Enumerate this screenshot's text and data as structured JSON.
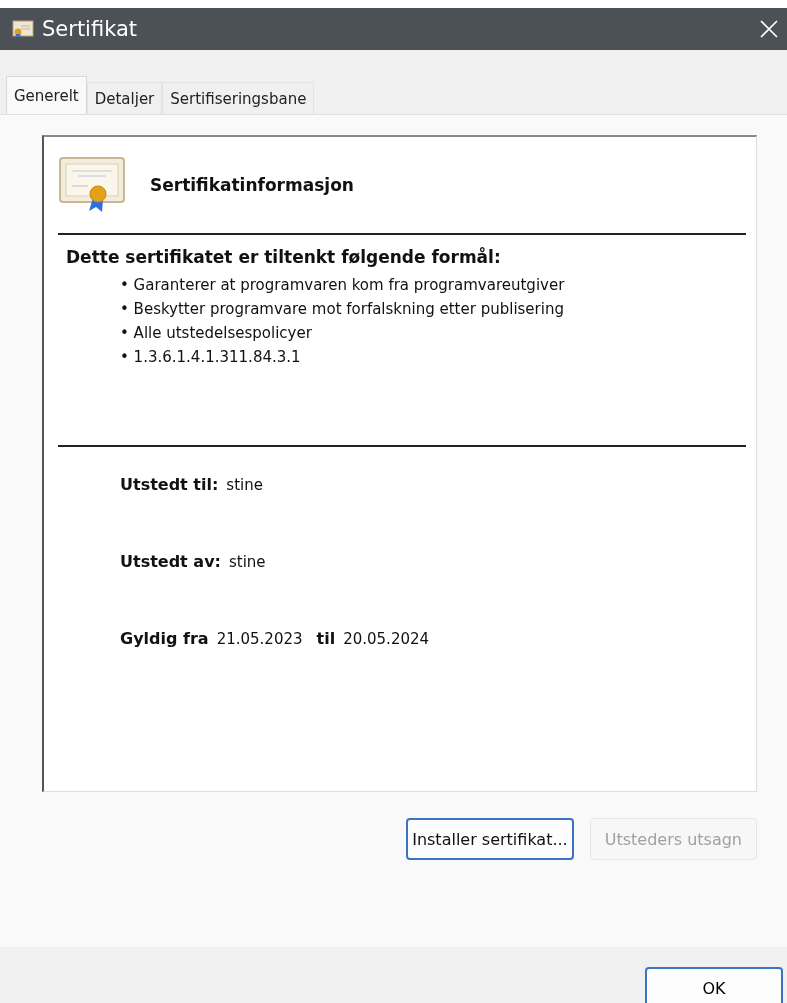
{
  "window": {
    "title": "Sertifikat"
  },
  "tabs": [
    {
      "label": "Generelt",
      "selected": true
    },
    {
      "label": "Detaljer",
      "selected": false
    },
    {
      "label": "Sertifiseringsbane",
      "selected": false
    }
  ],
  "info": {
    "heading": "Sertifikatinformasjon",
    "purpose_title": "Dette sertifikatet er tiltenkt følgende formål:",
    "purposes": [
      "• Garanterer at programvaren kom fra programvareutgiver",
      "• Beskytter programvare mot forfalskning etter publisering",
      "• Alle utstedelsespolicyer",
      "• 1.3.6.1.4.1.311.84.3.1"
    ],
    "issued_to": {
      "label": "Utstedt til:",
      "value": "stine"
    },
    "issued_by": {
      "label": "Utstedt av:",
      "value": "stine"
    },
    "validity": {
      "from_label": "Gyldig fra",
      "from": "21.05.2023",
      "to_label": "til",
      "to": "20.05.2024"
    }
  },
  "buttons": [
    {
      "label": "Installer sertifikat...",
      "disabled": false
    },
    {
      "label": "Utsteders utsagn",
      "disabled": true
    }
  ],
  "footer": {
    "ok": "OK"
  }
}
